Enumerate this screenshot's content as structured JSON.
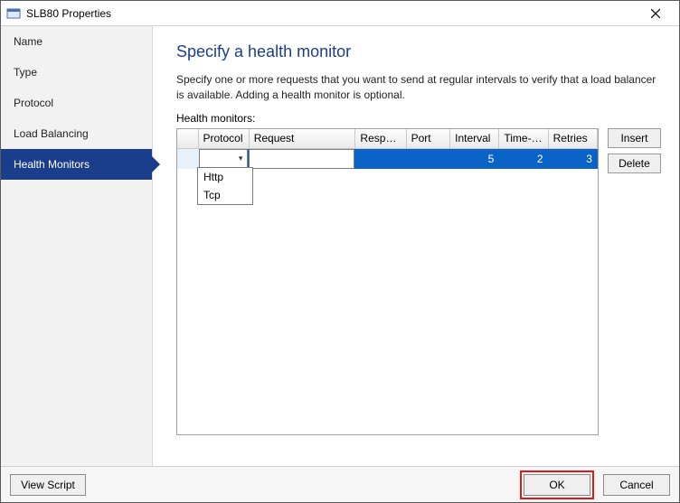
{
  "window": {
    "title": "SLB80 Properties"
  },
  "sidebar": {
    "items": [
      {
        "label": "Name"
      },
      {
        "label": "Type"
      },
      {
        "label": "Protocol"
      },
      {
        "label": "Load Balancing"
      },
      {
        "label": "Health Monitors",
        "selected": true
      }
    ]
  },
  "page": {
    "title": "Specify a health monitor",
    "description": "Specify one or more requests that you want to send at regular intervals to verify that a load balancer is available. Adding a health monitor is optional.",
    "listLabel": "Health monitors:"
  },
  "grid": {
    "columns": [
      "Protocol",
      "Request",
      "Respo…",
      "Port",
      "Interval",
      "Time-…",
      "Retries"
    ],
    "row": {
      "protocol": "",
      "request": "",
      "response": "",
      "port": "",
      "interval": "5",
      "timeout": "2",
      "retries": "3"
    },
    "protocolOptions": [
      "Http",
      "Tcp"
    ]
  },
  "actions": {
    "insert": "Insert",
    "delete": "Delete"
  },
  "footer": {
    "viewScript": "View Script",
    "ok": "OK",
    "cancel": "Cancel"
  }
}
